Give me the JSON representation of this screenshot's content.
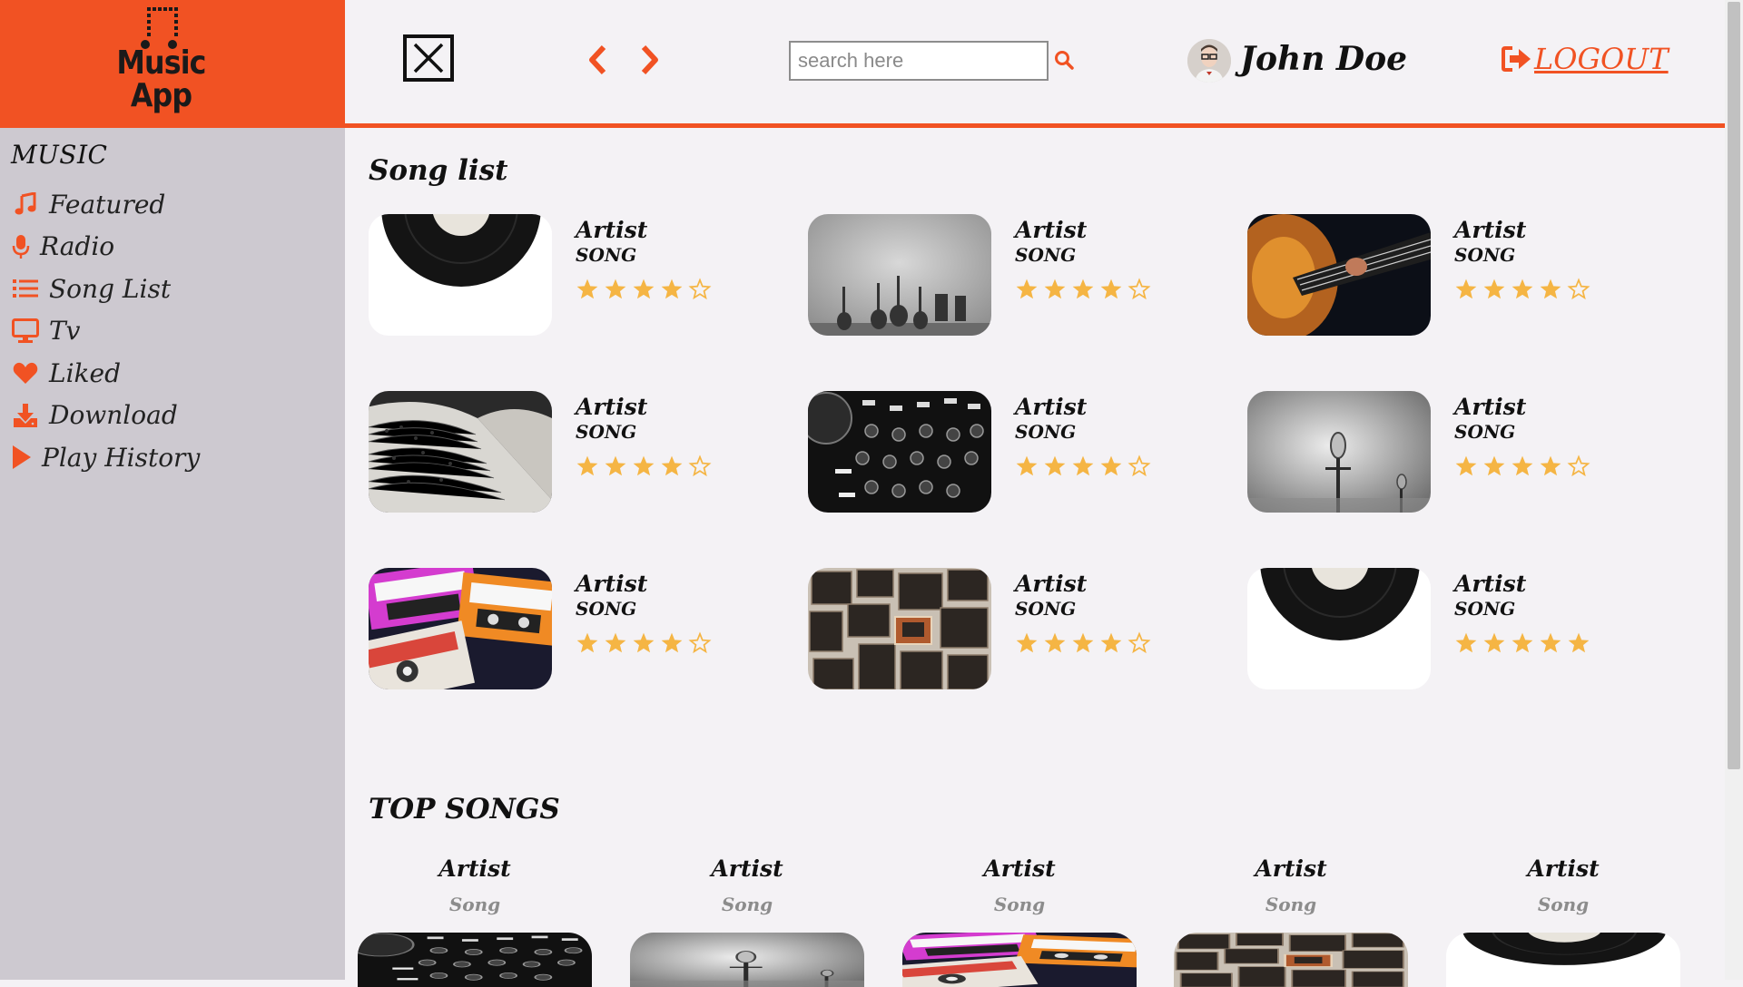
{
  "app": {
    "logo_line1": "Music",
    "logo_line2": "App"
  },
  "colors": {
    "accent": "#f15223",
    "sidebar_bg": "#cdc9d0",
    "star": "#f5b544",
    "main_bg": "#f4f2f5"
  },
  "sidebar": {
    "heading": "MUSIC",
    "items": [
      {
        "label": "Featured",
        "icon": "music-note-icon"
      },
      {
        "label": "Radio",
        "icon": "microphone-icon"
      },
      {
        "label": "Song List",
        "icon": "list-icon"
      },
      {
        "label": "Tv",
        "icon": "monitor-icon"
      },
      {
        "label": "Liked",
        "icon": "heart-icon"
      },
      {
        "label": "Download",
        "icon": "download-icon"
      },
      {
        "label": "Play History",
        "icon": "play-icon"
      }
    ]
  },
  "header": {
    "close_icon": "close-icon",
    "back_icon": "chevron-left-icon",
    "forward_icon": "chevron-right-icon",
    "search": {
      "placeholder": "search here",
      "value": ""
    },
    "user_name": "John Doe",
    "logout_label": "LOGOUT"
  },
  "song_list": {
    "title": "Song list",
    "items": [
      {
        "artist": "Artist",
        "song": "SONG",
        "rating": 4,
        "image": "vinyl-record"
      },
      {
        "artist": "Artist",
        "song": "SONG",
        "rating": 4,
        "image": "guitars-lineup"
      },
      {
        "artist": "Artist",
        "song": "SONG",
        "rating": 4,
        "image": "bass-guitar"
      },
      {
        "artist": "Artist",
        "song": "SONG",
        "rating": 4,
        "image": "sheet-music"
      },
      {
        "artist": "Artist",
        "song": "SONG",
        "rating": 4,
        "image": "dj-mixer"
      },
      {
        "artist": "Artist",
        "song": "SONG",
        "rating": 4,
        "image": "microphone-stand"
      },
      {
        "artist": "Artist",
        "song": "SONG",
        "rating": 4,
        "image": "cassette-tapes"
      },
      {
        "artist": "Artist",
        "song": "SONG",
        "rating": 4,
        "image": "amplifier-wall"
      },
      {
        "artist": "Artist",
        "song": "SONG",
        "rating": 5,
        "image": "vinyl-record"
      }
    ]
  },
  "top_songs": {
    "title": "TOP SONGS",
    "items": [
      {
        "artist": "Artist",
        "song": "Song",
        "image": "dj-mixer"
      },
      {
        "artist": "Artist",
        "song": "Song",
        "image": "microphone-stand"
      },
      {
        "artist": "Artist",
        "song": "Song",
        "image": "cassette-tapes"
      },
      {
        "artist": "Artist",
        "song": "Song",
        "image": "amplifier-wall"
      },
      {
        "artist": "Artist",
        "song": "Song",
        "image": "vinyl-record"
      }
    ]
  }
}
